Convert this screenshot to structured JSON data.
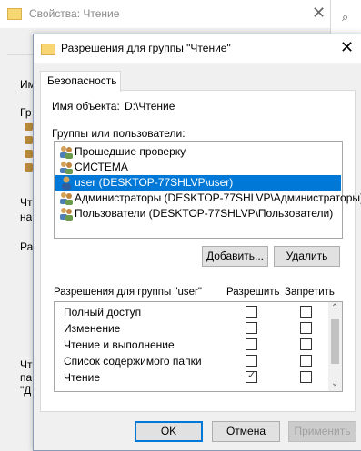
{
  "background_window": {
    "title": "Свойства: Чтение",
    "fragments": [
      "Им",
      "Гр",
      "Чт",
      "на",
      "Ра",
      "Чт",
      "па",
      "\"Д"
    ]
  },
  "dialog": {
    "title": "Разрешения для группы \"Чтение\"",
    "close_glyph": "✕",
    "tab_label": "Безопасность",
    "object_name_label": "Имя объекта:",
    "object_name_value": "D:\\Чтение",
    "groups_label": "Группы или пользователи:",
    "groups": [
      {
        "label": "Прошедшие проверку",
        "icon": "group-icon",
        "selected": false
      },
      {
        "label": "СИСТЕМА",
        "icon": "group-icon",
        "selected": false
      },
      {
        "label": "user (DESKTOP-77SHLVP\\user)",
        "icon": "user-icon",
        "selected": true
      },
      {
        "label": "Администраторы (DESKTOP-77SHLVP\\Администраторы)",
        "icon": "group-icon",
        "selected": false
      },
      {
        "label": "Пользователи (DESKTOP-77SHLVP\\Пользователи)",
        "icon": "group-icon",
        "selected": false
      }
    ],
    "add_button": "Добавить...",
    "remove_button": "Удалить",
    "permissions_label": "Разрешения для группы \"user\"",
    "allow_header": "Разрешить",
    "deny_header": "Запретить",
    "permissions": [
      {
        "name": "Полный доступ",
        "allow": false,
        "deny": false
      },
      {
        "name": "Изменение",
        "allow": false,
        "deny": false
      },
      {
        "name": "Чтение и выполнение",
        "allow": false,
        "deny": false
      },
      {
        "name": "Список содержимого папки",
        "allow": false,
        "deny": false
      },
      {
        "name": "Чтение",
        "allow": true,
        "deny": false
      }
    ],
    "ok_button": "OK",
    "cancel_button": "Отмена",
    "apply_button": "Применить"
  },
  "colors": {
    "selection": "#0078d7",
    "primary_border": "#0078d7"
  }
}
